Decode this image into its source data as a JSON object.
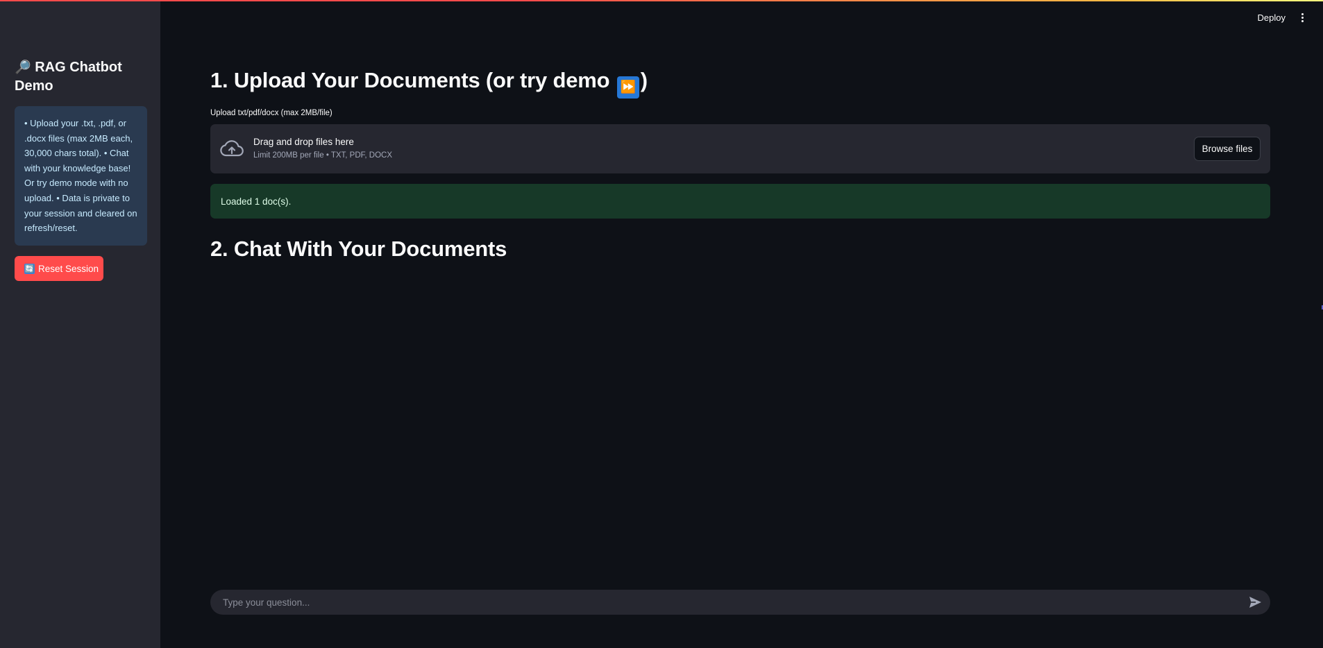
{
  "colors": {
    "background": "#0e1117",
    "sidebar": "#262730",
    "accent": "#ff4b4b",
    "info_bg": "#2a3a50",
    "success_bg": "#173928"
  },
  "sidebar": {
    "title_icon": "🔎",
    "title": "RAG Chatbot Demo",
    "info_text": "• Upload your .txt, .pdf, or .docx files (max 2MB each, 30,000 chars total). • Chat with your knowledge base! Or try demo mode with no upload. • Data is private to your session and cleared on refresh/reset.",
    "reset_button": {
      "icon": "🔄",
      "label": "Reset Session"
    }
  },
  "header": {
    "deploy_label": "Deploy",
    "menu_icon": "kebab-menu-icon"
  },
  "upload_section": {
    "heading": "1. Upload Your Documents (or try demo",
    "heading_icon": "⏩",
    "heading_close": ")",
    "uploader_label": "Upload txt/pdf/docx (max 2MB/file)",
    "dropzone": {
      "icon": "cloud-upload-icon",
      "title": "Drag and drop files here",
      "subtitle": "Limit 200MB per file • TXT, PDF, DOCX",
      "browse_label": "Browse files"
    },
    "status": "Loaded 1 doc(s)."
  },
  "chat_section": {
    "heading": "2. Chat With Your Documents",
    "input_placeholder": "Type your question...",
    "input_value": "",
    "send_icon": "send-icon"
  }
}
